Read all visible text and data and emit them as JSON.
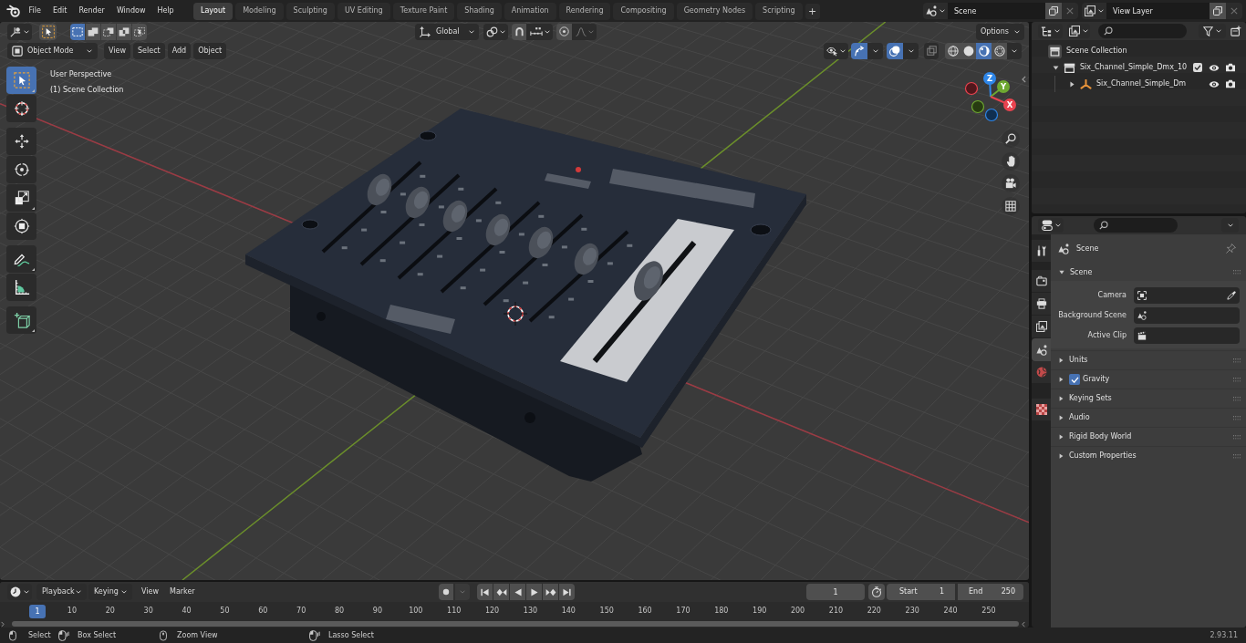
{
  "top_bar": {
    "menus": [
      "File",
      "Edit",
      "Render",
      "Window",
      "Help"
    ],
    "workspaces": [
      {
        "label": "Layout",
        "selected": true
      },
      {
        "label": "Modeling",
        "selected": false
      },
      {
        "label": "Sculpting",
        "selected": false
      },
      {
        "label": "UV Editing",
        "selected": false
      },
      {
        "label": "Texture Paint",
        "selected": false
      },
      {
        "label": "Shading",
        "selected": false
      },
      {
        "label": "Animation",
        "selected": false
      },
      {
        "label": "Rendering",
        "selected": false
      },
      {
        "label": "Compositing",
        "selected": false
      },
      {
        "label": "Geometry Nodes",
        "selected": false
      },
      {
        "label": "Scripting",
        "selected": false
      }
    ],
    "add_workspace": "+",
    "scene": "Scene",
    "view_layer": "View Layer"
  },
  "viewport": {
    "tool_header": {
      "selection_modes": [
        {
          "selected": true
        },
        {
          "selected": false
        },
        {
          "selected": false
        },
        {
          "selected": false
        },
        {
          "selected": false
        }
      ],
      "orientation": "Global",
      "snap": {
        "on": false
      },
      "proportional": {
        "on": false
      },
      "options": "Options"
    },
    "header": {
      "mode": "Object Mode",
      "menus": [
        "View",
        "Select",
        "Add",
        "Object"
      ],
      "gizmos": {
        "on": true
      },
      "overlays": {
        "on": true
      },
      "xray": {
        "on": false
      },
      "shading": [
        {
          "selected": false
        },
        {
          "selected": false
        },
        {
          "selected": true
        },
        {
          "selected": false
        }
      ]
    },
    "view_name": "User Perspective",
    "collection": "(1) Scene Collection",
    "toolbar": [
      [
        {
          "selected": true,
          "more": true
        },
        {
          "selected": false,
          "more": false
        }
      ],
      [
        {
          "selected": false,
          "more": false
        },
        {
          "selected": false,
          "more": false
        },
        {
          "selected": false,
          "more": true
        },
        {
          "selected": false,
          "more": false
        }
      ],
      [
        {
          "selected": false,
          "more": true
        },
        {
          "selected": false,
          "more": false
        }
      ],
      [
        {
          "selected": false,
          "more": true
        }
      ]
    ],
    "gizmo_axes": [
      {
        "label": "Z",
        "color": "#2e86e8"
      },
      {
        "label": "Y",
        "color": "#6ea831"
      },
      {
        "label": "X",
        "color": "#e8434f"
      }
    ]
  },
  "outliner": {
    "tree": [
      {
        "kind": "scene_collection",
        "label": "Scene Collection",
        "children": [
          {
            "kind": "collection",
            "label": "Six_Channel_Simple_Dmx_10",
            "expanded": true,
            "checked": true,
            "visible": true,
            "render": true,
            "children": [
              {
                "kind": "object",
                "label": "Six_Channel_Simple_Dm",
                "expanded": false,
                "visible": true,
                "render": true
              }
            ]
          }
        ]
      }
    ]
  },
  "properties": {
    "tabs": [
      [
        {
          "selected": false
        }
      ],
      [
        {
          "selected": false
        },
        {
          "selected": false
        },
        {
          "selected": false
        },
        {
          "selected": true
        },
        {
          "selected": false
        }
      ],
      [
        {
          "selected": false
        }
      ]
    ],
    "context": "Scene",
    "panel": {
      "title": "Scene",
      "expanded": true,
      "fields": [
        {
          "kind": "camera",
          "label": "Camera"
        },
        {
          "kind": "scene",
          "label": "Background Scene"
        },
        {
          "kind": "clip",
          "label": "Active Clip"
        }
      ]
    },
    "subpanels": [
      {
        "label": "Units",
        "expanded": false
      },
      {
        "label": "Gravity",
        "expanded": false,
        "checked": true
      },
      {
        "label": "Keying Sets",
        "expanded": false
      },
      {
        "label": "Audio",
        "expanded": false
      },
      {
        "label": "Rigid Body World",
        "expanded": false
      },
      {
        "label": "Custom Properties",
        "expanded": false
      }
    ]
  },
  "timeline": {
    "dropdowns": [
      "Playback",
      "Keying"
    ],
    "menus": [
      "View",
      "Marker"
    ],
    "auto_keying": {
      "on": false
    },
    "current_frame": "1",
    "preview_range": {
      "on": false
    },
    "start": {
      "label": "Start",
      "value": "1"
    },
    "end": {
      "label": "End",
      "value": "250"
    },
    "playhead": "1",
    "ruler": [
      "10",
      "20",
      "30",
      "40",
      "50",
      "60",
      "70",
      "80",
      "90",
      "100",
      "110",
      "120",
      "130",
      "140",
      "150",
      "160",
      "170",
      "180",
      "190",
      "200",
      "210",
      "220",
      "230",
      "240",
      "250"
    ]
  },
  "status_bar": {
    "hints": [
      {
        "kind": "click",
        "label": "Select"
      },
      {
        "kind": "drag",
        "label": "Box Select"
      },
      {
        "kind": "middle",
        "label": "Zoom View"
      },
      {
        "kind": "drag",
        "label": "Lasso Select"
      }
    ],
    "version": "2.93.11"
  }
}
